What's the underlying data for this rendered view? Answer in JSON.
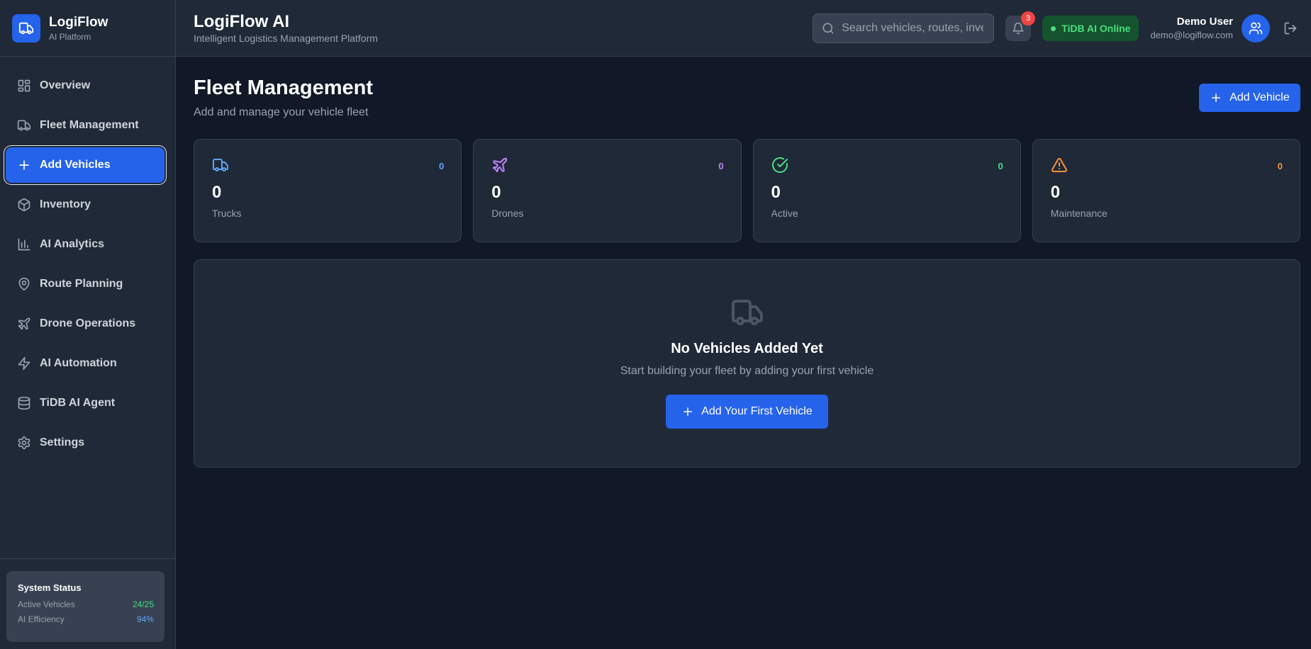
{
  "brand": {
    "name": "LogiFlow",
    "subtitle": "AI Platform"
  },
  "sidebar": {
    "items": [
      {
        "label": "Overview",
        "icon": "grid-icon"
      },
      {
        "label": "Fleet Management",
        "icon": "truck-icon"
      },
      {
        "label": "Add Vehicles",
        "icon": "plus-icon",
        "active": true
      },
      {
        "label": "Inventory",
        "icon": "package-icon"
      },
      {
        "label": "AI Analytics",
        "icon": "bar-chart-icon"
      },
      {
        "label": "Route Planning",
        "icon": "map-pin-icon"
      },
      {
        "label": "Drone Operations",
        "icon": "plane-icon"
      },
      {
        "label": "AI Automation",
        "icon": "zap-icon"
      },
      {
        "label": "TiDB AI Agent",
        "icon": "database-icon"
      },
      {
        "label": "Settings",
        "icon": "gear-icon"
      }
    ],
    "status": {
      "title": "System Status",
      "rows": [
        {
          "label": "Active Vehicles",
          "value": "24/25"
        },
        {
          "label": "AI Efficiency",
          "value": "94%"
        }
      ]
    }
  },
  "header": {
    "title": "LogiFlow AI",
    "subtitle": "Intelligent Logistics Management Platform",
    "search_placeholder": "Search vehicles, routes, inventory...",
    "notification_count": "3",
    "online_label": "TiDB AI Online",
    "user_name": "Demo User",
    "user_email": "demo@logiflow.com"
  },
  "page": {
    "title": "Fleet Management",
    "subtitle": "Add and manage your vehicle fleet",
    "add_button": "Add Vehicle"
  },
  "stats": [
    {
      "label": "Trucks",
      "value": "0",
      "count": "0",
      "icon": "truck-icon",
      "color": "#60a5fa"
    },
    {
      "label": "Drones",
      "value": "0",
      "count": "0",
      "icon": "plane-icon",
      "color": "#c084fc"
    },
    {
      "label": "Active",
      "value": "0",
      "count": "0",
      "icon": "check-circle-icon",
      "color": "#4ade80"
    },
    {
      "label": "Maintenance",
      "value": "0",
      "count": "0",
      "icon": "alert-triangle-icon",
      "color": "#fb923c"
    }
  ],
  "empty_state": {
    "title": "No Vehicles Added Yet",
    "subtitle": "Start building your fleet by adding your first vehicle",
    "button": "Add Your First Vehicle"
  }
}
